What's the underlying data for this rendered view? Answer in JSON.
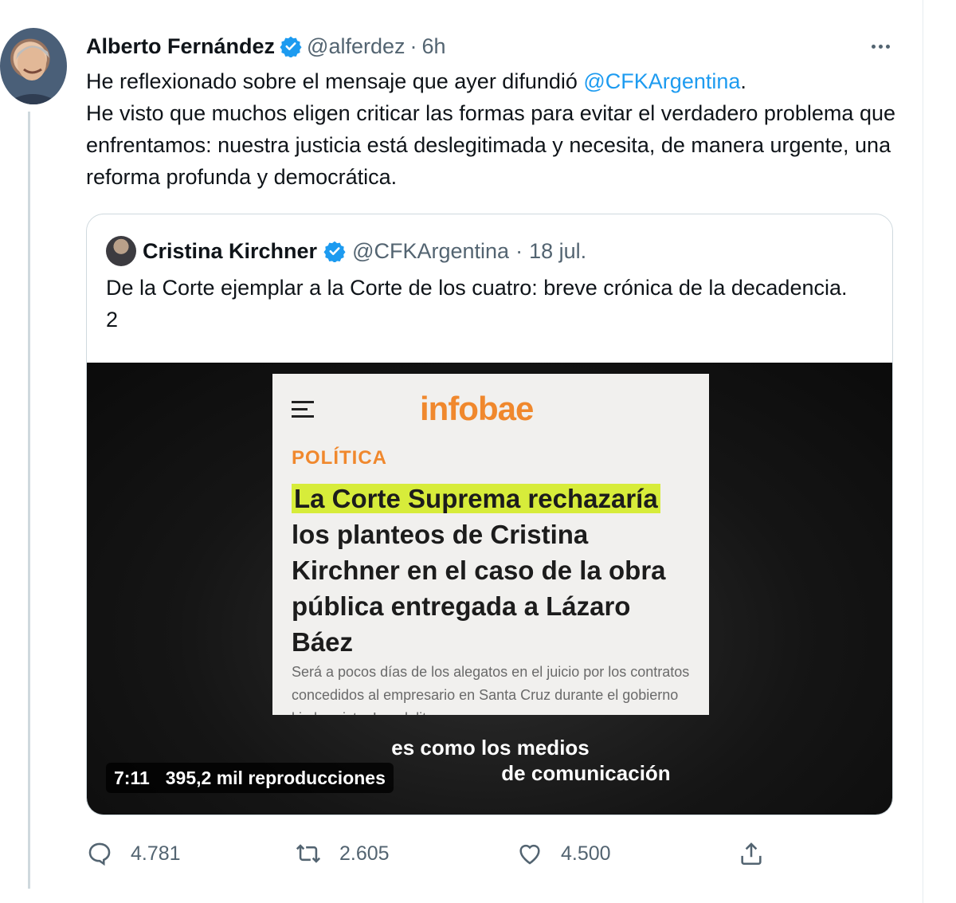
{
  "tweet": {
    "author": {
      "display_name": "Alberto Fernández",
      "handle": "@alferdez",
      "separator": "·",
      "time": "6h"
    },
    "text": {
      "line1_prefix": "He reflexionado sobre el mensaje que ayer difundió ",
      "line1_mention": "@CFKArgentina",
      "line1_suffix": ".",
      "paragraph2": "He visto que muchos eligen criticar las formas para evitar el verdadero problema que enfrentamos: nuestra justicia está deslegitimada y necesita, de manera urgente, una reforma profunda y democrática."
    },
    "quote": {
      "display_name": "Cristina Kirchner",
      "handle": "@CFKArgentina",
      "separator": "·",
      "date": "18 jul.",
      "text": "De la Corte ejemplar a la Corte de los cuatro: breve crónica de la decadencia. 2",
      "media": {
        "article_logo": "infobae",
        "article_section": "POLÍTICA",
        "headline_highlight": "La Corte Suprema rechazaría",
        "headline_rest": " los planteos de Cristina Kirchner en el caso de la obra pública entregada a Lázaro Báez",
        "summary": "Será a pocos días de los alegatos en el juicio por los contratos concedidos al empresario en Santa Cruz durante el gobierno kirchnerista. Los delitos",
        "caption_line1": "es como los medios",
        "caption_line2": "de comunicación",
        "duration": "7:11",
        "views": "395,2 mil reproducciones"
      }
    },
    "actions": {
      "replies": "4.781",
      "retweets": "2.605",
      "likes": "4.500"
    },
    "icons": {
      "verified": "verified-badge-icon",
      "more": "more-options-icon",
      "reply": "reply-icon",
      "retweet": "retweet-icon",
      "like": "heart-icon",
      "share": "share-icon",
      "menu": "hamburger-menu-icon"
    },
    "colors": {
      "accent": "#1d9bf0",
      "secondary_text": "#536471",
      "infobae_orange": "#f0882d",
      "highlight": "#d7ec3a"
    }
  }
}
